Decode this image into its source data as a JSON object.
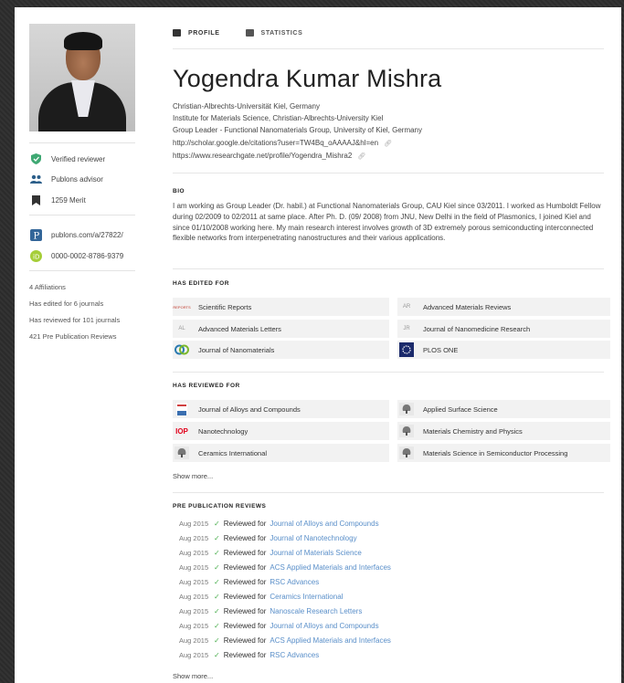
{
  "tabs": {
    "profile": "PROFILE",
    "statistics": "STATISTICS"
  },
  "profile": {
    "name": "Yogendra Kumar Mishra",
    "affiliations": [
      "Christian-Albrechts-Universität Kiel, Germany",
      "Institute for Materials Science, Christian-Albrechts-University Kiel",
      "Group Leader - Functional Nanomaterials Group, University of Kiel, Germany",
      "http://scholar.google.de/citations?user=TW4Bq_oAAAAJ&hl=en",
      "https://www.researchgate.net/profile/Yogendra_Mishra2"
    ]
  },
  "sidebar": {
    "badges": [
      {
        "label": "Verified reviewer",
        "icon": "verified-shield-icon"
      },
      {
        "label": "Publons advisor",
        "icon": "group-icon"
      },
      {
        "label": "1259 Merit",
        "icon": "bookmark-icon"
      }
    ],
    "links": [
      {
        "label": "publons.com/a/27822/",
        "icon": "publons-p-icon"
      },
      {
        "label": "0000-0002-8786-9379",
        "icon": "orcid-icon"
      }
    ],
    "stats": [
      "4 Affiliations",
      "Has edited for 6 journals",
      "Has reviewed for 101 journals",
      "421 Pre Publication Reviews"
    ]
  },
  "bio": {
    "title": "BIO",
    "text": "I am working as Group Leader (Dr. habil.) at Functional Nanomaterials Group, CAU Kiel since 03/2011. I worked as Humboldt Fellow during 02/2009 to 02/2011 at same place. After Ph. D. (09/ 2008) from JNU, New Delhi in the field of Plasmonics, I joined Kiel and since 01/10/2008 working here. My main research interest involves growth of 3D extremely porous semiconducting interconnected flexible networks from interpenetrating nanostructures and their various applications."
  },
  "edited": {
    "title": "HAS EDITED FOR",
    "journals": [
      {
        "name": "Scientific Reports",
        "logo": "REPORTS"
      },
      {
        "name": "Advanced Materials Reviews",
        "logo": "AR"
      },
      {
        "name": "Advanced Materials Letters",
        "logo": "AL"
      },
      {
        "name": "Journal of Nanomedicine Research",
        "logo": "JR"
      },
      {
        "name": "Journal of Nanomaterials",
        "logo": ""
      },
      {
        "name": "PLOS ONE",
        "logo": ""
      }
    ]
  },
  "reviewed": {
    "title": "HAS REVIEWED FOR",
    "journals": [
      {
        "name": "Journal of Alloys and Compounds",
        "logo": ""
      },
      {
        "name": "Applied Surface Science",
        "logo": ""
      },
      {
        "name": "Nanotechnology",
        "logo": "IOP"
      },
      {
        "name": "Materials Chemistry and Physics",
        "logo": ""
      },
      {
        "name": "Ceramics International",
        "logo": ""
      },
      {
        "name": "Materials Science in Semiconductor Processing",
        "logo": ""
      }
    ],
    "show_more": "Show more..."
  },
  "prepub": {
    "title": "PRE PUBLICATION REVIEWS",
    "reviewed_for_label": "Reviewed for",
    "check": "✓",
    "rows": [
      {
        "date": "Aug 2015",
        "journal": "Journal of Alloys and Compounds"
      },
      {
        "date": "Aug 2015",
        "journal": "Journal of Nanotechnology"
      },
      {
        "date": "Aug 2015",
        "journal": "Journal of Materials Science"
      },
      {
        "date": "Aug 2015",
        "journal": "ACS Applied Materials and Interfaces"
      },
      {
        "date": "Aug 2015",
        "journal": "RSC Advances"
      },
      {
        "date": "Aug 2015",
        "journal": "Ceramics International"
      },
      {
        "date": "Aug 2015",
        "journal": "Nanoscale Research Letters"
      },
      {
        "date": "Aug 2015",
        "journal": "Journal of Alloys and Compounds"
      },
      {
        "date": "Aug 2015",
        "journal": "ACS Applied Materials and Interfaces"
      },
      {
        "date": "Aug 2015",
        "journal": "RSC Advances"
      }
    ],
    "show_more": "Show more..."
  },
  "colors": {
    "link": "#5a8fc9",
    "check": "#4caf50",
    "verified": "#3fa873",
    "orcid": "#a6ce39",
    "publons": "#336699"
  }
}
